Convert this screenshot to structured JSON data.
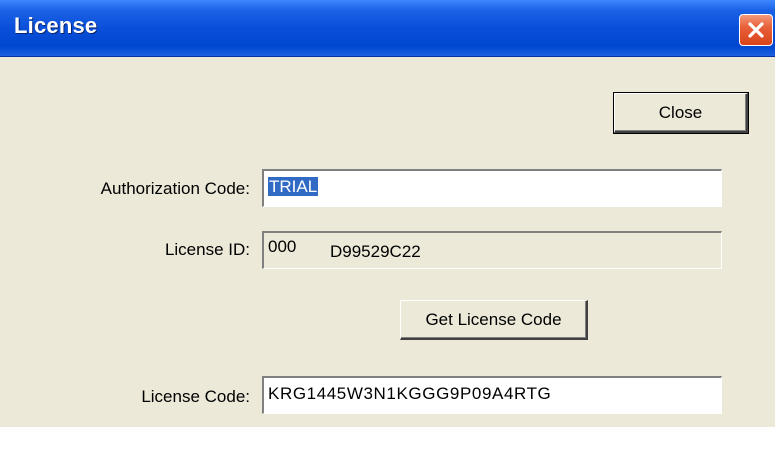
{
  "window": {
    "title": "License"
  },
  "buttons": {
    "close_label": "Close",
    "get_license_label": "Get License Code"
  },
  "fields": {
    "authorization": {
      "label": "Authorization Code:",
      "value": "TRIAL"
    },
    "license_id": {
      "label": "License ID:",
      "value_prefix": "000",
      "value": "D99529C22"
    },
    "license_code": {
      "label": "License Code:",
      "value": "KRG1445W3N1KGGG9P09A4RTG"
    }
  },
  "colors": {
    "titlebar": "#0a4fd9",
    "dialog_bg": "#ece9d8",
    "selection": "#316ac5",
    "close_button": "#e8603a"
  }
}
